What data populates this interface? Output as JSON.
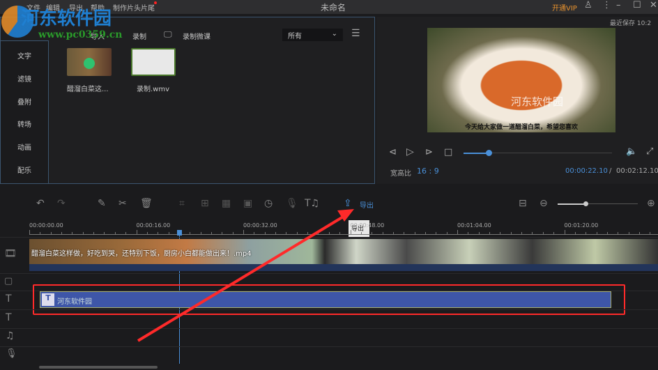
{
  "title": "未命名",
  "menu": [
    "文件",
    "编辑",
    "导出",
    "帮助",
    "制作片头片尾"
  ],
  "watermark": {
    "name": "河东软件园",
    "url": "www.pc0359.cn"
  },
  "topright": {
    "vip": "开通VIP",
    "last_saved": "最近保存 10:2"
  },
  "media_toolbar": {
    "import": "导入",
    "record": "录制",
    "record_course": "录制微课",
    "filter": "所有"
  },
  "sidebar": [
    "文字",
    "滤镜",
    "叠附",
    "转场",
    "动画",
    "配乐"
  ],
  "media_items": [
    {
      "name": "醋溜白菜这..."
    },
    {
      "name": "录制.wmv"
    }
  ],
  "preview": {
    "subtitle": "今天给大家做一道醋溜白菜，希望您喜欢",
    "watermark": "河东软件园",
    "aspect_label": "宽高比",
    "aspect": "16 : 9",
    "current": "00:00:22.10",
    "separator": "/",
    "total": "00:02:12.10",
    "progress": 0.17
  },
  "toolbar": {
    "export": "导出",
    "tooltip": "导出",
    "zoom": 0.35
  },
  "ruler": [
    "00:00:00.00",
    "00:00:16.00",
    "00:00:32.00",
    "00:00:48.00",
    "00:01:04.00",
    "00:01:20.00"
  ],
  "video_clip": "醋溜白菜这样做，好吃到哭，还特别下饭，厨房小白都能做出来！.mp4",
  "text_clip": "河东软件园",
  "colors": {
    "accent": "#4a90d9",
    "vip": "#e8922e",
    "highlight": "#ff2a2a",
    "text_clip": "#3e56a8"
  }
}
